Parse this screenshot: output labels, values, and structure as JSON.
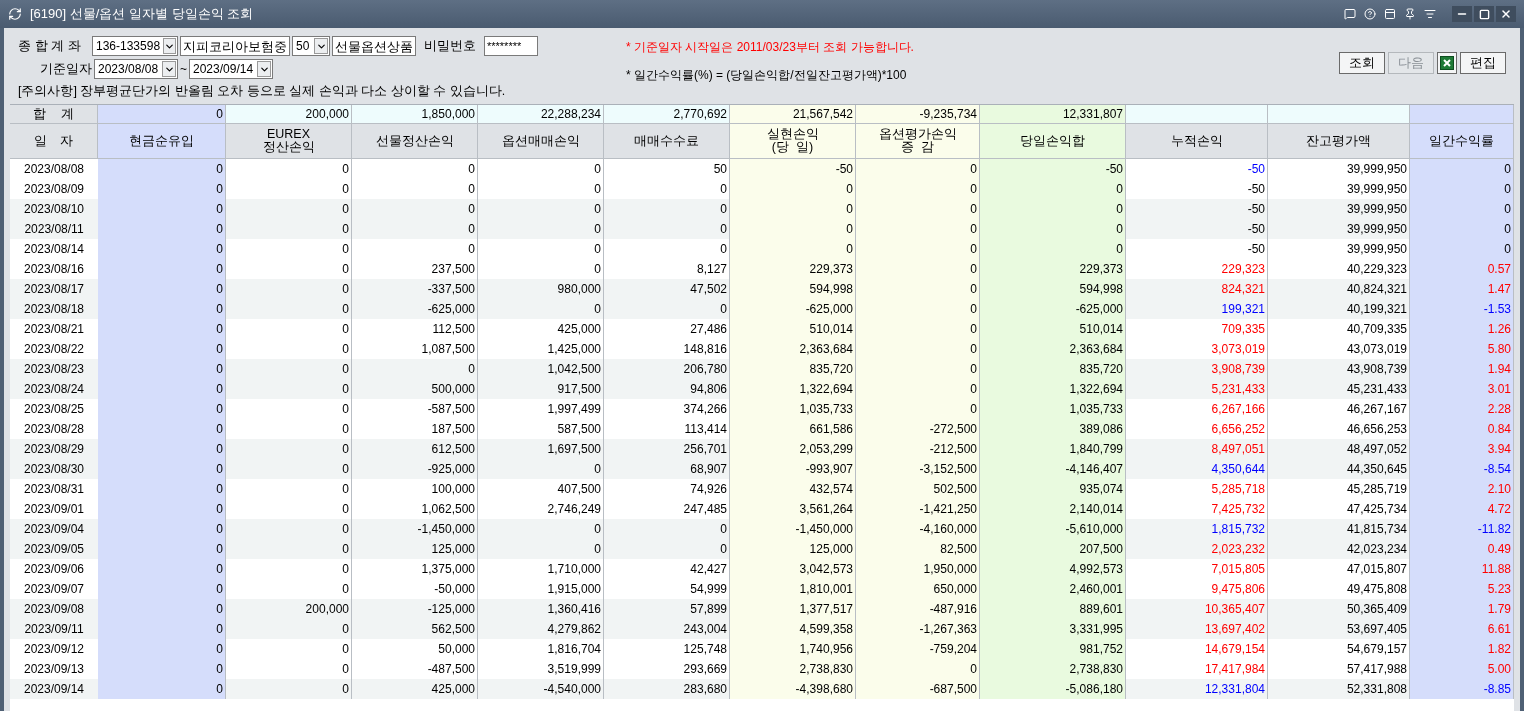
{
  "window": {
    "title": "[6190] 선물/옵션 일자별 당일손익 조회"
  },
  "form": {
    "account_label": "종 합 계 좌",
    "account": "136-133598",
    "account_name": "지피코리아보험중",
    "sub_account": "50",
    "product": "선물옵션상품",
    "password_label": "비밀번호",
    "password": "********",
    "date_label": "기준일자",
    "date_from": "2023/08/08",
    "date_separator": "~",
    "date_to": "2023/09/14",
    "caution": "[주의사항] 장부평균단가의 반올림 오차 등으로 실제 손익과 다소 상이할 수 있습니다.",
    "note_1": "* 기준일자 시작일은 2011/03/23부터 조회 가능합니다.",
    "note_2": "* 일간수익률(%) = (당일손익합/전일잔고평가액)*100"
  },
  "buttons": [
    {
      "kind": "text",
      "label": "조회",
      "disabled": false
    },
    {
      "kind": "text",
      "label": "다음",
      "disabled": true
    },
    {
      "kind": "excel",
      "disabled": false
    },
    {
      "kind": "text",
      "label": "편집",
      "disabled": false
    }
  ],
  "table": {
    "columns": [
      {
        "label": "일    자"
      },
      {
        "label": "현금순유입",
        "color": "#d5ddfb"
      },
      {
        "label": "EUREX\n정산손익"
      },
      {
        "label": "선물정산손익"
      },
      {
        "label": "옵션매매손익"
      },
      {
        "label": "매매수수료"
      },
      {
        "label": "실현손익\n(당  일)",
        "color": "#fbfdeb"
      },
      {
        "label": "옵션평가손익\n증  감",
        "color": "#fbfdeb"
      },
      {
        "label": "당일손익합",
        "color": "#e9fadf"
      },
      {
        "label": "누적손익"
      },
      {
        "label": "잔고평가액"
      },
      {
        "label": "일간수익률",
        "color": "#d5ddfb"
      }
    ],
    "sum_row": {
      "label": "합    계",
      "values": [
        "0",
        "200,000",
        "1,850,000",
        "22,288,234",
        "2,770,692",
        "21,567,542",
        "-9,235,734",
        "12,331,807"
      ]
    },
    "rows": [
      {
        "date": "2023/08/08",
        "cells": [
          "0",
          "0",
          "0",
          "0",
          "50",
          "-50",
          "0",
          "-50"
        ],
        "cumulative": {
          "text": "-50",
          "color": "#0000ff"
        },
        "balance": "39,999,950",
        "daily_return": {
          "text": "0"
        }
      },
      {
        "date": "2023/08/09",
        "cells": [
          "0",
          "0",
          "0",
          "0",
          "0",
          "0",
          "0",
          "0"
        ],
        "cumulative": {
          "text": "-50"
        },
        "balance": "39,999,950",
        "daily_return": {
          "text": "0"
        }
      },
      {
        "date": "2023/08/10",
        "cells": [
          "0",
          "0",
          "0",
          "0",
          "0",
          "0",
          "0",
          "0"
        ],
        "cumulative": {
          "text": "-50"
        },
        "balance": "39,999,950",
        "daily_return": {
          "text": "0"
        }
      },
      {
        "date": "2023/08/11",
        "cells": [
          "0",
          "0",
          "0",
          "0",
          "0",
          "0",
          "0",
          "0"
        ],
        "cumulative": {
          "text": "-50"
        },
        "balance": "39,999,950",
        "daily_return": {
          "text": "0"
        }
      },
      {
        "date": "2023/08/14",
        "cells": [
          "0",
          "0",
          "0",
          "0",
          "0",
          "0",
          "0",
          "0"
        ],
        "cumulative": {
          "text": "-50"
        },
        "balance": "39,999,950",
        "daily_return": {
          "text": "0"
        }
      },
      {
        "date": "2023/08/16",
        "cells": [
          "0",
          "0",
          "237,500",
          "0",
          "8,127",
          "229,373",
          "0",
          "229,373"
        ],
        "cumulative": {
          "text": "229,323",
          "color": "#ff0000"
        },
        "balance": "40,229,323",
        "daily_return": {
          "text": "0.57",
          "color": "#ff0000"
        }
      },
      {
        "date": "2023/08/17",
        "cells": [
          "0",
          "0",
          "-337,500",
          "980,000",
          "47,502",
          "594,998",
          "0",
          "594,998"
        ],
        "cumulative": {
          "text": "824,321",
          "color": "#ff0000"
        },
        "balance": "40,824,321",
        "daily_return": {
          "text": "1.47",
          "color": "#ff0000"
        }
      },
      {
        "date": "2023/08/18",
        "cells": [
          "0",
          "0",
          "-625,000",
          "0",
          "0",
          "-625,000",
          "0",
          "-625,000"
        ],
        "cumulative": {
          "text": "199,321",
          "color": "#0000ff"
        },
        "balance": "40,199,321",
        "daily_return": {
          "text": "-1.53",
          "color": "#0000ff"
        }
      },
      {
        "date": "2023/08/21",
        "cells": [
          "0",
          "0",
          "112,500",
          "425,000",
          "27,486",
          "510,014",
          "0",
          "510,014"
        ],
        "cumulative": {
          "text": "709,335",
          "color": "#ff0000"
        },
        "balance": "40,709,335",
        "daily_return": {
          "text": "1.26",
          "color": "#ff0000"
        }
      },
      {
        "date": "2023/08/22",
        "cells": [
          "0",
          "0",
          "1,087,500",
          "1,425,000",
          "148,816",
          "2,363,684",
          "0",
          "2,363,684"
        ],
        "cumulative": {
          "text": "3,073,019",
          "color": "#ff0000"
        },
        "balance": "43,073,019",
        "daily_return": {
          "text": "5.80",
          "color": "#ff0000"
        }
      },
      {
        "date": "2023/08/23",
        "cells": [
          "0",
          "0",
          "0",
          "1,042,500",
          "206,780",
          "835,720",
          "0",
          "835,720"
        ],
        "cumulative": {
          "text": "3,908,739",
          "color": "#ff0000"
        },
        "balance": "43,908,739",
        "daily_return": {
          "text": "1.94",
          "color": "#ff0000"
        }
      },
      {
        "date": "2023/08/24",
        "cells": [
          "0",
          "0",
          "500,000",
          "917,500",
          "94,806",
          "1,322,694",
          "0",
          "1,322,694"
        ],
        "cumulative": {
          "text": "5,231,433",
          "color": "#ff0000"
        },
        "balance": "45,231,433",
        "daily_return": {
          "text": "3.01",
          "color": "#ff0000"
        }
      },
      {
        "date": "2023/08/25",
        "cells": [
          "0",
          "0",
          "-587,500",
          "1,997,499",
          "374,266",
          "1,035,733",
          "0",
          "1,035,733"
        ],
        "cumulative": {
          "text": "6,267,166",
          "color": "#ff0000"
        },
        "balance": "46,267,167",
        "daily_return": {
          "text": "2.28",
          "color": "#ff0000"
        }
      },
      {
        "date": "2023/08/28",
        "cells": [
          "0",
          "0",
          "187,500",
          "587,500",
          "113,414",
          "661,586",
          "-272,500",
          "389,086"
        ],
        "cumulative": {
          "text": "6,656,252",
          "color": "#ff0000"
        },
        "balance": "46,656,253",
        "daily_return": {
          "text": "0.84",
          "color": "#ff0000"
        }
      },
      {
        "date": "2023/08/29",
        "cells": [
          "0",
          "0",
          "612,500",
          "1,697,500",
          "256,701",
          "2,053,299",
          "-212,500",
          "1,840,799"
        ],
        "cumulative": {
          "text": "8,497,051",
          "color": "#ff0000"
        },
        "balance": "48,497,052",
        "daily_return": {
          "text": "3.94",
          "color": "#ff0000"
        }
      },
      {
        "date": "2023/08/30",
        "cells": [
          "0",
          "0",
          "-925,000",
          "0",
          "68,907",
          "-993,907",
          "-3,152,500",
          "-4,146,407"
        ],
        "cumulative": {
          "text": "4,350,644",
          "color": "#0000ff"
        },
        "balance": "44,350,645",
        "daily_return": {
          "text": "-8.54",
          "color": "#0000ff"
        }
      },
      {
        "date": "2023/08/31",
        "cells": [
          "0",
          "0",
          "100,000",
          "407,500",
          "74,926",
          "432,574",
          "502,500",
          "935,074"
        ],
        "cumulative": {
          "text": "5,285,718",
          "color": "#ff0000"
        },
        "balance": "45,285,719",
        "daily_return": {
          "text": "2.10",
          "color": "#ff0000"
        }
      },
      {
        "date": "2023/09/01",
        "cells": [
          "0",
          "0",
          "1,062,500",
          "2,746,249",
          "247,485",
          "3,561,264",
          "-1,421,250",
          "2,140,014"
        ],
        "cumulative": {
          "text": "7,425,732",
          "color": "#ff0000"
        },
        "balance": "47,425,734",
        "daily_return": {
          "text": "4.72",
          "color": "#ff0000"
        }
      },
      {
        "date": "2023/09/04",
        "cells": [
          "0",
          "0",
          "-1,450,000",
          "0",
          "0",
          "-1,450,000",
          "-4,160,000",
          "-5,610,000"
        ],
        "cumulative": {
          "text": "1,815,732",
          "color": "#0000ff"
        },
        "balance": "41,815,734",
        "daily_return": {
          "text": "-11.82",
          "color": "#0000ff"
        }
      },
      {
        "date": "2023/09/05",
        "cells": [
          "0",
          "0",
          "125,000",
          "0",
          "0",
          "125,000",
          "82,500",
          "207,500"
        ],
        "cumulative": {
          "text": "2,023,232",
          "color": "#ff0000"
        },
        "balance": "42,023,234",
        "daily_return": {
          "text": "0.49",
          "color": "#ff0000"
        }
      },
      {
        "date": "2023/09/06",
        "cells": [
          "0",
          "0",
          "1,375,000",
          "1,710,000",
          "42,427",
          "3,042,573",
          "1,950,000",
          "4,992,573"
        ],
        "cumulative": {
          "text": "7,015,805",
          "color": "#ff0000"
        },
        "balance": "47,015,807",
        "daily_return": {
          "text": "11.88",
          "color": "#ff0000"
        }
      },
      {
        "date": "2023/09/07",
        "cells": [
          "0",
          "0",
          "-50,000",
          "1,915,000",
          "54,999",
          "1,810,001",
          "650,000",
          "2,460,001"
        ],
        "cumulative": {
          "text": "9,475,806",
          "color": "#ff0000"
        },
        "balance": "49,475,808",
        "daily_return": {
          "text": "5.23",
          "color": "#ff0000"
        }
      },
      {
        "date": "2023/09/08",
        "cells": [
          "0",
          "200,000",
          "-125,000",
          "1,360,416",
          "57,899",
          "1,377,517",
          "-487,916",
          "889,601"
        ],
        "cumulative": {
          "text": "10,365,407",
          "color": "#ff0000"
        },
        "balance": "50,365,409",
        "daily_return": {
          "text": "1.79",
          "color": "#ff0000"
        }
      },
      {
        "date": "2023/09/11",
        "cells": [
          "0",
          "0",
          "562,500",
          "4,279,862",
          "243,004",
          "4,599,358",
          "-1,267,363",
          "3,331,995"
        ],
        "cumulative": {
          "text": "13,697,402",
          "color": "#ff0000"
        },
        "balance": "53,697,405",
        "daily_return": {
          "text": "6.61",
          "color": "#ff0000"
        }
      },
      {
        "date": "2023/09/12",
        "cells": [
          "0",
          "0",
          "50,000",
          "1,816,704",
          "125,748",
          "1,740,956",
          "-759,204",
          "981,752"
        ],
        "cumulative": {
          "text": "14,679,154",
          "color": "#ff0000"
        },
        "balance": "54,679,157",
        "daily_return": {
          "text": "1.82",
          "color": "#ff0000"
        }
      },
      {
        "date": "2023/09/13",
        "cells": [
          "0",
          "0",
          "-487,500",
          "3,519,999",
          "293,669",
          "2,738,830",
          "0",
          "2,738,830"
        ],
        "cumulative": {
          "text": "17,417,984",
          "color": "#ff0000"
        },
        "balance": "57,417,988",
        "daily_return": {
          "text": "5.00",
          "color": "#ff0000"
        }
      },
      {
        "date": "2023/09/14",
        "cells": [
          "0",
          "0",
          "425,000",
          "-4,540,000",
          "283,680",
          "-4,398,680",
          "-687,500",
          "-5,086,180"
        ],
        "cumulative": {
          "text": "12,331,804",
          "color": "#0000ff"
        },
        "balance": "52,331,808",
        "daily_return": {
          "text": "-8.85",
          "color": "#0000ff"
        }
      }
    ]
  }
}
